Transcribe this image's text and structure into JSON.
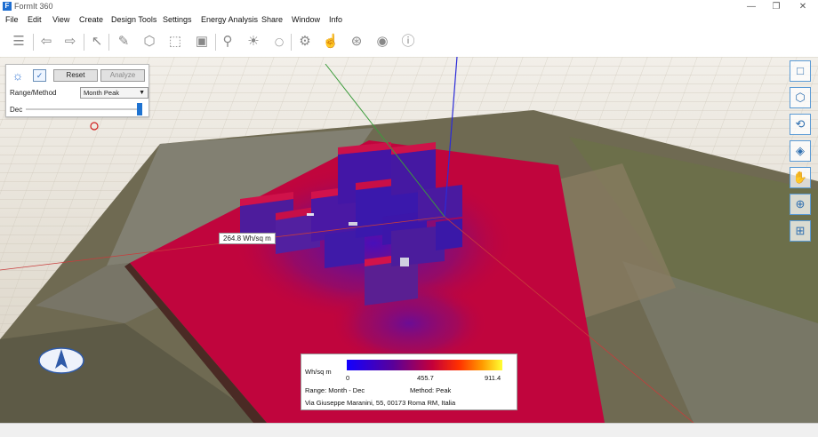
{
  "window": {
    "title": "FormIt 360",
    "icon": "formit-app-icon"
  },
  "menu": [
    "File",
    "Edit",
    "View",
    "Create",
    "Design Tools",
    "Settings",
    "Energy Analysis",
    "Share",
    "Window",
    "Info"
  ],
  "toolbar_icons": [
    "layers-icon",
    "undo-icon",
    "redo-icon",
    "select-icon",
    "sketch-icon",
    "cube-icon",
    "push-pull-icon",
    "group-icon",
    "location-icon",
    "sun-icon",
    "render-360-icon",
    "settings-icon",
    "gesture-icon",
    "share-icon",
    "user-icon",
    "info-icon"
  ],
  "solar_panel": {
    "reset": "Reset",
    "analyze": "Analyze",
    "range_label": "Range/Method",
    "method_value": "Month Peak",
    "month_label": "Dec",
    "slider_value": 1.0
  },
  "right_tools": [
    "zoom-extents-icon",
    "view-cube-icon",
    "orbit-icon",
    "camera-icon",
    "pan-hand-icon",
    "zoom-icon",
    "zoom-window-icon"
  ],
  "probe": {
    "value": "264.8 Wh/sq m"
  },
  "legend": {
    "unit": "Wh/sq m",
    "min": "0",
    "mid": "455.7",
    "max": "911.4",
    "range": "Range: Month - Dec",
    "method": "Method: Peak",
    "address": "Via Giuseppe Maranini, 55, 00173 Roma RM, Italia",
    "colors": [
      "#1200ff",
      "#5a0099",
      "#c4003a",
      "#ff3000",
      "#ff9a00",
      "#ffff33"
    ]
  }
}
